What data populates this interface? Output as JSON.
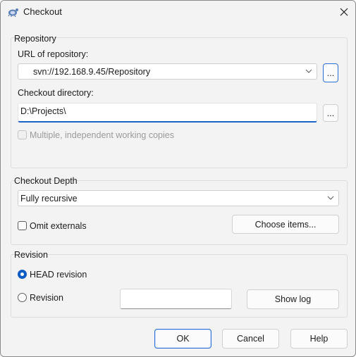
{
  "window": {
    "title": "Checkout",
    "app_icon": "tortoisesvn-icon",
    "close_icon": "close-icon"
  },
  "repository": {
    "group_label": "Repository",
    "url_label": "URL of repository:",
    "url_value": "svn://192.168.9.45/Repository",
    "url_browse_label": "...",
    "dir_label": "Checkout directory:",
    "dir_value": "D:\\Projects\\",
    "dir_browse_label": "...",
    "multiple_copies_label": "Multiple, independent working copies",
    "multiple_copies_checked": false
  },
  "depth": {
    "group_label": "Checkout Depth",
    "depth_value": "Fully recursive",
    "omit_externals_label": "Omit externals",
    "omit_externals_checked": false,
    "choose_items_label": "Choose items..."
  },
  "revision": {
    "group_label": "Revision",
    "head_label": "HEAD revision",
    "head_checked": true,
    "revision_label": "Revision",
    "revision_value": "",
    "show_log_label": "Show log"
  },
  "buttons": {
    "ok": "OK",
    "cancel": "Cancel",
    "help": "Help"
  },
  "colors": {
    "accent": "#0f5bc4",
    "window_bg": "#f3f3f3"
  }
}
